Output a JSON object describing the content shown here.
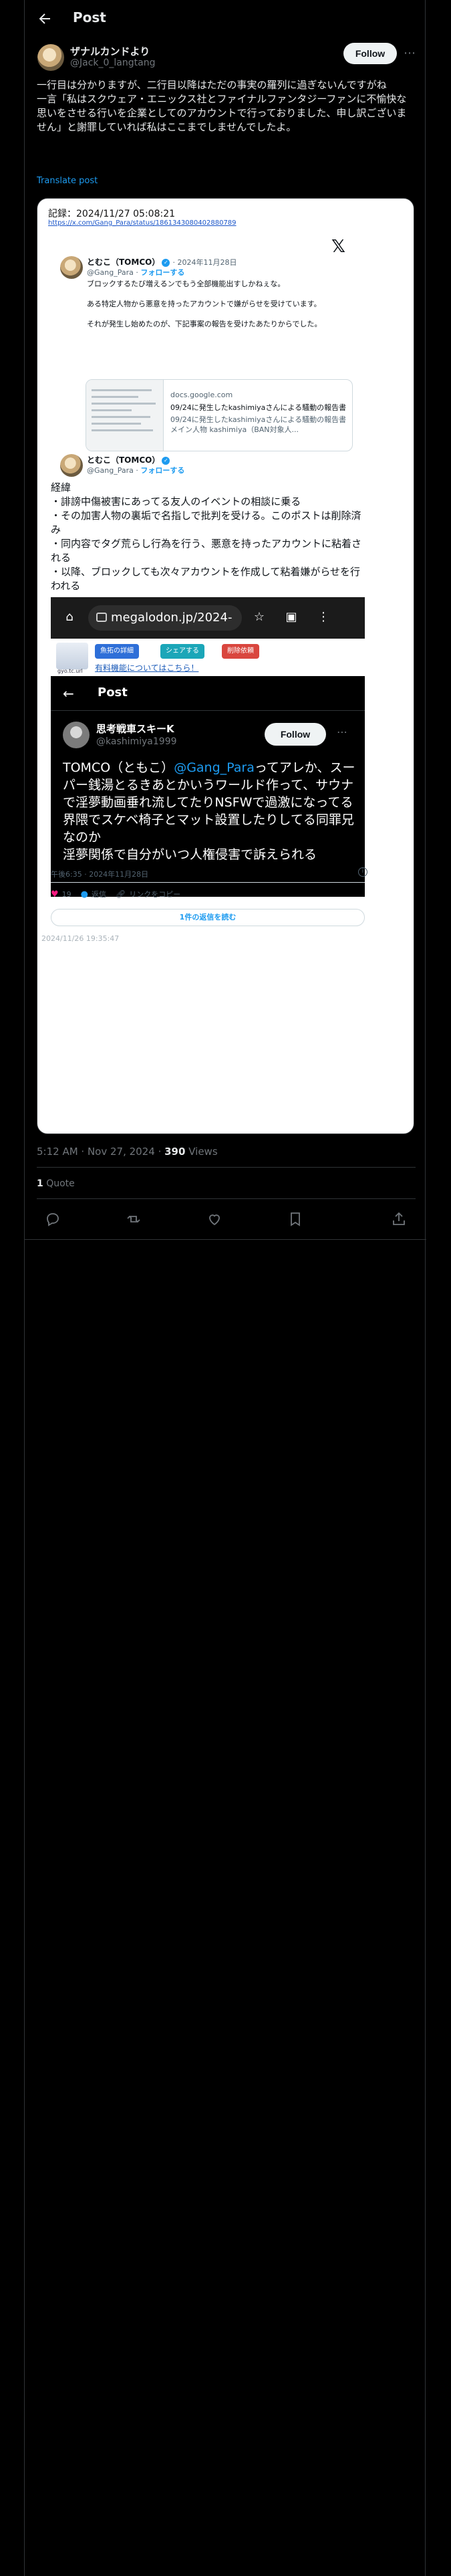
{
  "header": {
    "title": "Post"
  },
  "author": {
    "name": "ザナルカンドより",
    "handle": "@Jack_0_langtang",
    "follow_label": "Follow"
  },
  "tweet": {
    "text": "一行目は分かりますが、二行目以降はただの事実の羅列に過ぎないんですがね\n一言「私はスクウェア・エニックス社とファイナルファンタジーファンに不愉快な思いをさせる行いを企業としてのアカウントで行っておりました、申し訳ございません」と謝罪していれば私はここまでしませんでしたよ。",
    "translate_label": "Translate post",
    "time": "5:12 AM · Nov 27, 2024",
    "views_count": "390",
    "views_label": "Views",
    "quotes_count": "1",
    "quotes_label": "Quote"
  },
  "media": {
    "record_line": "記録：2024/11/27 05:08:21",
    "record_url": "https://x.com/Gang_Para/status/1861343080402880789",
    "first_post": {
      "name": "とむこ（TOMCO）",
      "date": "· 2024年11月28日",
      "handle": "@Gang_Para",
      "follow": "フォローする",
      "text": "ブロックするたび増えるンでもう全部機能出すしかねぇな。\n\nある特定人物から悪意を持ったアカウントで嫌がらせを受けています。\n\nそれが発生し始めたのが、下記事案の報告を受けたあたりからでした。"
    },
    "link_card": {
      "domain": "docs.google.com",
      "title": "09/24に発生したkashimiyaさんによる騒動の報告書",
      "desc": "09/24に発生したkashimiyaさんによる騒動の報告書 メイン人物 kashimiya（BAN対象人..."
    },
    "second_post": {
      "name": "とむこ（TOMCO）",
      "handle": "@Gang_Para",
      "follow": "フォローする",
      "text": "経緯\n・誹謗中傷被害にあってる友人のイベントの相談に乗る\n・その加害人物の裏垢で名指しで批判を受ける。このポストは削除済み\n・同内容でタグ荒らし行為を行う、悪意を持ったアカウントに粘着される\n・以降、ブロックしても次々アカウントを作成して粘着嫌がらせを行われる"
    },
    "phone": {
      "url": "megalodon.jp/2024-",
      "ad_logo_text": "gyo.tc.url",
      "ad_buttons": [
        "魚拓の詳細",
        "シェアする",
        "削除依頼"
      ],
      "ad_note": "有料機能についてはこちら！",
      "x_header": "Post",
      "x_name": "思考戦車スキーK",
      "x_handle": "@kashimiya1999",
      "x_follow": "Follow",
      "x_text_pre": "TOMCO（ともこ）",
      "x_mention": "@Gang_Para",
      "x_text_post": "ってアレか、スーパー銭湯とるきあとかいうワールド作って、サウナで淫夢動画垂れ流してたりNSFWで過激になってる界隈でスケベ椅子とマット設置したりしてる同罪兄なのか\n淫夢関係で自分がいつ人権侵害で訴えられる"
    },
    "meta": "午後6:35 · 2024年11月28日",
    "likes": "19",
    "reply_label": "返信",
    "copy_label": "リンクをコピー",
    "replies_button": "1件の返信を読む",
    "stamp": "2024/11/26 19:35:47"
  },
  "colors": {
    "accent": "#1d9bf0",
    "like": "#f91880",
    "bg": "#000000",
    "border": "#2f3336"
  },
  "icons": [
    "back-arrow-icon",
    "more-icon",
    "x-logo-icon",
    "reply-icon",
    "repost-icon",
    "like-icon",
    "bookmark-icon",
    "share-icon"
  ]
}
